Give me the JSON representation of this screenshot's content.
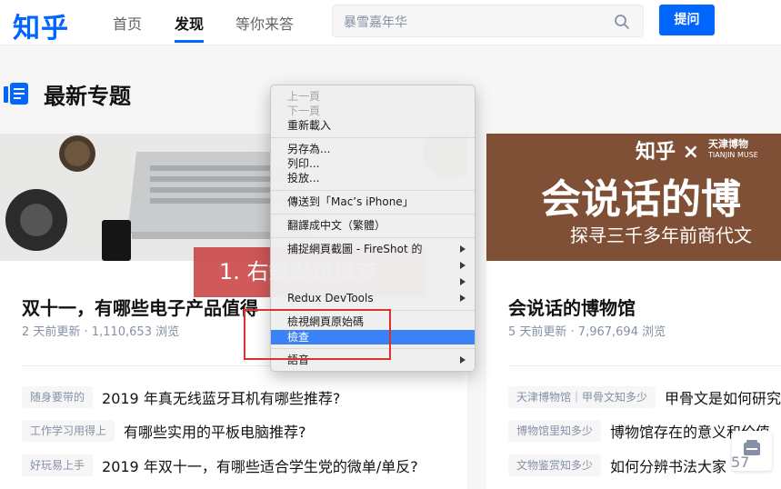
{
  "header": {
    "logo": "知乎",
    "nav": [
      "首页",
      "发现",
      "等你来答"
    ],
    "search_placeholder": "暴雪嘉年华",
    "ask_button": "提问"
  },
  "section": {
    "title": "最新专题"
  },
  "cards": [
    {
      "title": "双十一，有哪些电子产品值得",
      "meta": "2 天前更新 · 1,110,653 浏览",
      "rows": [
        {
          "tag": "随身要带的",
          "question": "2019 年真无线蓝牙耳机有哪些推荐?"
        },
        {
          "tag": "工作学习用得上",
          "question": "有哪些实用的平板电脑推荐?"
        },
        {
          "tag": "好玩易上手",
          "question": "2019 年双十一，有哪些适合学生党的微单/单反?"
        }
      ]
    },
    {
      "title": "会说话的博物馆",
      "meta": "5 天前更新 · 7,967,694 浏览",
      "banner_brand": "知乎 × ",
      "banner_partner": "天津博物",
      "banner_partner_en": "TIANJIN MUSE",
      "banner_headline": "会说话的博",
      "banner_sub": "探寻三千多年前商代文",
      "rows": [
        {
          "tag": "天津博物馆｜甲骨文知多少",
          "question": "甲骨文是如何研究"
        },
        {
          "tag": "博物馆里知多少",
          "question": "博物馆存在的意义和价值"
        },
        {
          "tag": "文物鉴赏知多少",
          "question": "如何分辨书法大家"
        }
      ]
    }
  ],
  "context_menu": {
    "items": [
      {
        "label": "上一頁",
        "disabled": true
      },
      {
        "label": "下一頁",
        "disabled": true
      },
      {
        "label": "重新載入"
      },
      {
        "label": "另存為..."
      },
      {
        "label": "列印..."
      },
      {
        "label": "投放..."
      },
      {
        "label": "傳送到「Mac’s iPhone」"
      },
      {
        "label": "翻譯成中文（繁體）"
      },
      {
        "label": "捕捉網頁截圖 - FireShot 的",
        "submenu": true
      },
      {
        "label": "",
        "submenu": true
      },
      {
        "label": "",
        "submenu": true
      },
      {
        "label": "Redux DevTools",
        "submenu": true
      },
      {
        "label": "檢視網頁原始碼"
      },
      {
        "label": "檢查",
        "selected": true
      },
      {
        "label": "語音",
        "submenu": true
      }
    ]
  },
  "annotation": {
    "label": "1. 右鍵點選檢查"
  },
  "floating": {
    "badge": "57"
  },
  "colors": {
    "brand": "#0066ff",
    "annotation": "#c83c3c",
    "highlight": "#3b82f6"
  }
}
